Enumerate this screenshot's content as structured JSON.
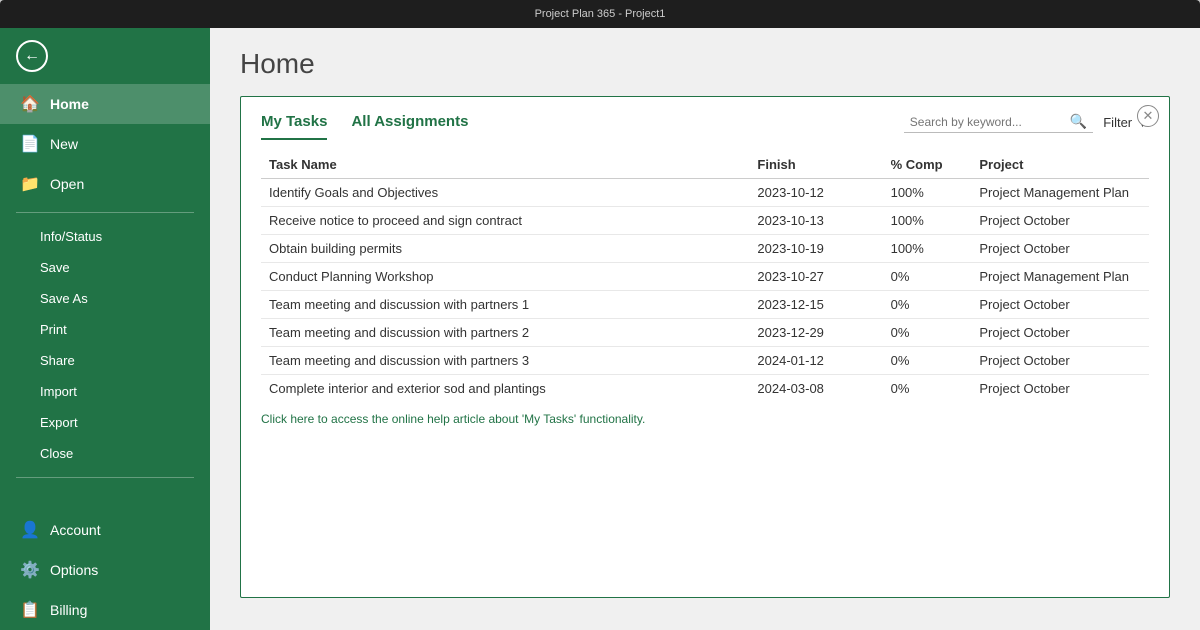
{
  "titleBar": {
    "text": "Project Plan 365 - Project1"
  },
  "sidebar": {
    "backLabel": "←",
    "items": [
      {
        "id": "home",
        "label": "Home",
        "icon": "🏠",
        "active": true
      },
      {
        "id": "new",
        "label": "New",
        "icon": "📄",
        "active": false
      },
      {
        "id": "open",
        "label": "Open",
        "icon": "📁",
        "active": false
      }
    ],
    "subItems": [
      {
        "id": "info-status",
        "label": "Info/Status"
      },
      {
        "id": "save",
        "label": "Save"
      },
      {
        "id": "save-as",
        "label": "Save As"
      },
      {
        "id": "print",
        "label": "Print"
      },
      {
        "id": "share",
        "label": "Share"
      },
      {
        "id": "import",
        "label": "Import"
      },
      {
        "id": "export",
        "label": "Export"
      },
      {
        "id": "close",
        "label": "Close"
      }
    ],
    "bottomItems": [
      {
        "id": "account",
        "label": "Account",
        "icon": "👤"
      },
      {
        "id": "options",
        "label": "Options",
        "icon": "⚙️"
      },
      {
        "id": "billing",
        "label": "Billing",
        "icon": "📋"
      }
    ]
  },
  "main": {
    "pageTitle": "Home",
    "tabs": [
      {
        "id": "my-tasks",
        "label": "My Tasks",
        "active": true
      },
      {
        "id": "all-assignments",
        "label": "All Assignments",
        "active": false
      }
    ],
    "search": {
      "placeholder": "Search by keyword..."
    },
    "filter": {
      "label": "Filter"
    },
    "table": {
      "columns": [
        {
          "id": "task-name",
          "label": "Task Name"
        },
        {
          "id": "finish",
          "label": "Finish"
        },
        {
          "id": "pct-comp",
          "label": "% Comp"
        },
        {
          "id": "project",
          "label": "Project"
        }
      ],
      "rows": [
        {
          "taskName": "Identify Goals and Objectives",
          "finish": "2023-10-12",
          "pctComp": "100%",
          "project": "Project Management Plan"
        },
        {
          "taskName": "Receive notice to proceed and sign contract",
          "finish": "2023-10-13",
          "pctComp": "100%",
          "project": "Project October"
        },
        {
          "taskName": "Obtain building permits",
          "finish": "2023-10-19",
          "pctComp": "100%",
          "project": "Project October"
        },
        {
          "taskName": "Conduct Planning Workshop",
          "finish": "2023-10-27",
          "pctComp": "0%",
          "project": "Project Management Plan"
        },
        {
          "taskName": "Team meeting and discussion with partners 1",
          "finish": "2023-12-15",
          "pctComp": "0%",
          "project": "Project October"
        },
        {
          "taskName": "Team meeting and discussion with partners 2",
          "finish": "2023-12-29",
          "pctComp": "0%",
          "project": "Project October"
        },
        {
          "taskName": "Team meeting and discussion with partners 3",
          "finish": "2024-01-12",
          "pctComp": "0%",
          "project": "Project October"
        },
        {
          "taskName": "Complete interior and exterior sod and plantings",
          "finish": "2024-03-08",
          "pctComp": "0%",
          "project": "Project October"
        }
      ]
    },
    "helpLink": "Click here to access the online help article about 'My Tasks' functionality."
  }
}
